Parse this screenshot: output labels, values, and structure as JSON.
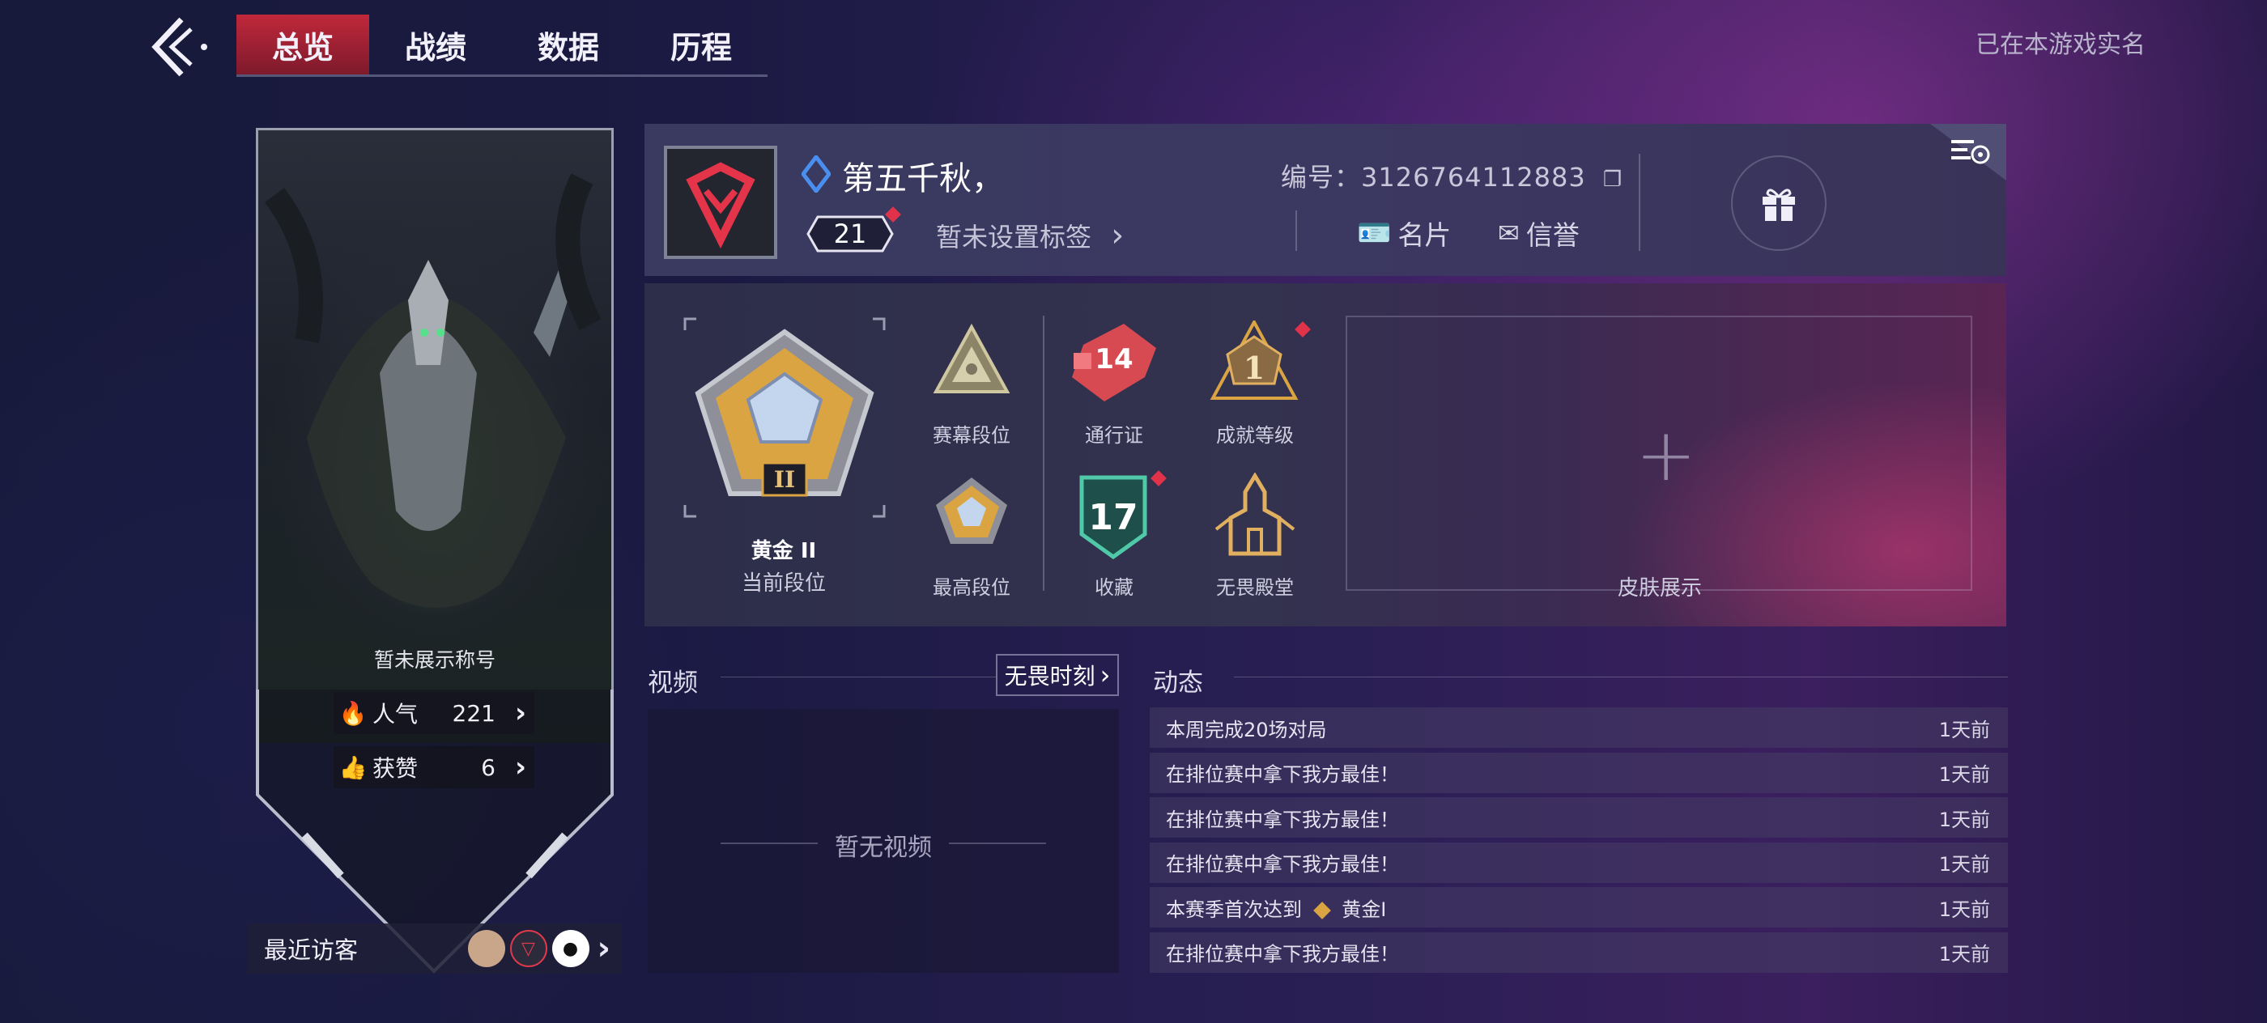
{
  "nav": {
    "tabs": [
      {
        "label": "总览",
        "active": true
      },
      {
        "label": "战绩",
        "active": false
      },
      {
        "label": "数据",
        "active": false
      },
      {
        "label": "历程",
        "active": false
      }
    ],
    "realname_text": "已在本游戏实名"
  },
  "hero": {
    "title_text": "暂未展示称号",
    "popularity": {
      "label": "人气",
      "value": "221"
    },
    "likes": {
      "label": "获赞",
      "value": "6"
    }
  },
  "visitors": {
    "label": "最近访客"
  },
  "profile": {
    "name": "第五千秋，",
    "level": "21",
    "tag_text": "暂未设置标签",
    "id_label": "编号：",
    "id_value": "3126764112883",
    "card_label": "名片",
    "credit_label": "信誉"
  },
  "ranks": {
    "current": {
      "tier": "黄金 II",
      "label": "当前段位"
    },
    "season": {
      "label": "赛幕段位"
    },
    "highest": {
      "label": "最高段位"
    },
    "pass": {
      "value": "14",
      "label": "通行证"
    },
    "achievement": {
      "value": "1",
      "label": "成就等级"
    },
    "collection": {
      "value": "17",
      "label": "收藏"
    },
    "hall": {
      "label": "无畏殿堂"
    },
    "skin_label": "皮肤展示"
  },
  "video": {
    "title": "视频",
    "moments_button": "无畏时刻",
    "empty_text": "暂无视频"
  },
  "feed": {
    "title": "动态",
    "items": [
      {
        "text": "本周完成20场对局",
        "time": "1天前"
      },
      {
        "text": "在排位赛中拿下我方最佳！",
        "time": "1天前"
      },
      {
        "text": "在排位赛中拿下我方最佳！",
        "time": "1天前"
      },
      {
        "text": "在排位赛中拿下我方最佳！",
        "time": "1天前"
      },
      {
        "text_prefix": "本赛季首次达到",
        "text_rank": "黄金I",
        "time": "1天前"
      },
      {
        "text": "在排位赛中拿下我方最佳！",
        "time": "1天前"
      }
    ]
  },
  "colors": {
    "accent_red": "#c0283a",
    "gold": "#d9a441",
    "teal": "#3fb39a"
  }
}
